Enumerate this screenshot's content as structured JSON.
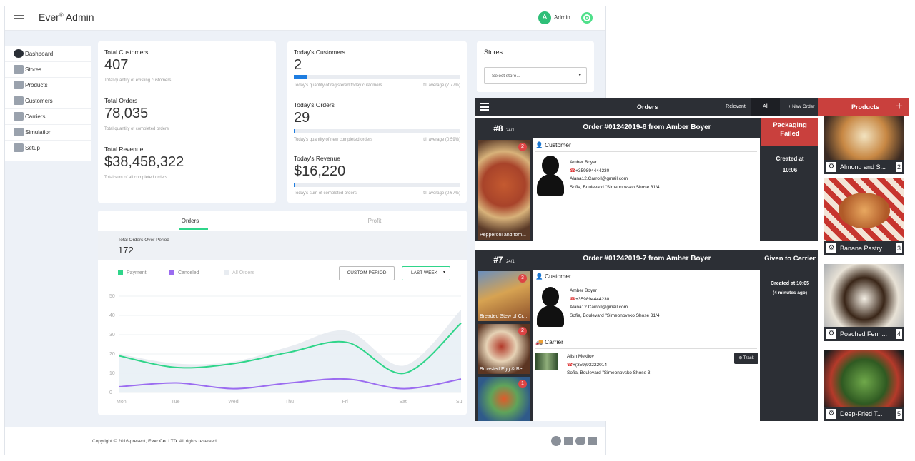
{
  "admin": {
    "brand": "Ever",
    "brand_sup": "®",
    "brand_suffix": " Admin",
    "avatar_letter": "A",
    "user": "Admin",
    "sidebar": [
      {
        "label": "Dashboard",
        "icon": "dashboard-icon"
      },
      {
        "label": "Stores",
        "icon": "stores-icon"
      },
      {
        "label": "Products",
        "icon": "products-icon"
      },
      {
        "label": "Customers",
        "icon": "customers-icon"
      },
      {
        "label": "Carriers",
        "icon": "carriers-icon"
      },
      {
        "label": "Simulation",
        "icon": "simulation-icon"
      },
      {
        "label": "Setup",
        "icon": "setup-icon"
      }
    ],
    "stats_left": [
      {
        "title": "Total Customers",
        "value": "407",
        "sub": "Total quantity of existing customers"
      },
      {
        "title": "Total Orders",
        "value": "78,035",
        "sub": "Total quantity of completed orders"
      },
      {
        "title": "Total Revenue",
        "value": "$38,458,322",
        "sub": "Total sum of all completed orders"
      }
    ],
    "stats_right": [
      {
        "title": "Today's Customers",
        "value": "2",
        "sub": "Today's quantity of registered today customers",
        "till": "till average (7.77%)",
        "percent": 7.77
      },
      {
        "title": "Today's Orders",
        "value": "29",
        "sub": "Today's quantity of new completed orders",
        "till": "till average (0.59%)",
        "percent": 0.59
      },
      {
        "title": "Today's Revenue",
        "value": "$16,220",
        "sub": "Today's sum of completed orders",
        "till": "till average (0.67%)",
        "percent": 0.67
      }
    ],
    "stores": {
      "title": "Stores",
      "placeholder": "Select store..."
    },
    "tabs": [
      "Orders",
      "Profit"
    ],
    "period_label": "Total Orders Over Period",
    "period_value": "172",
    "legend": [
      {
        "label": "Payment",
        "color": "#2fd58a"
      },
      {
        "label": "Canceled",
        "color": "#9b6cf0"
      },
      {
        "label": "All Orders",
        "color": "#e8ecf1"
      }
    ],
    "custom_period": "CUSTOM PERIOD",
    "last_week": "LAST WEEK",
    "footer_prefix": "Copyright © 2016-present, ",
    "footer_company": "Ever Co. LTD.",
    "footer_suffix": " All rights reserved."
  },
  "chart_data": {
    "type": "line",
    "x": [
      "Mon",
      "Tue",
      "Wed",
      "Thu",
      "Fri",
      "Sat",
      "Su"
    ],
    "ylim": [
      0,
      50
    ],
    "yticks": [
      "50",
      "40",
      "30",
      "20",
      "10",
      "0"
    ],
    "series": [
      {
        "name": "Payment",
        "values": [
          19,
          13,
          15,
          21,
          26,
          10,
          36
        ],
        "color": "#2fd58a"
      },
      {
        "name": "Canceled",
        "values": [
          3,
          5,
          2,
          5,
          7,
          2,
          7
        ],
        "color": "#9b6cf0"
      },
      {
        "name": "All Orders",
        "values": [
          20,
          15,
          16,
          24,
          32,
          14,
          43
        ],
        "color": "#e3e8ef"
      }
    ]
  },
  "orders_app": {
    "menu_icon": "hamburger-icon",
    "title": "Orders",
    "relevant": "Relevant",
    "all": "All",
    "new_order": "+ New Order",
    "products_title": "Products",
    "plus": "+",
    "orders": [
      {
        "num": "#8",
        "date": "24/1",
        "title": "Order #01242019-8 from Amber Boyer",
        "status": "Packaging Failed",
        "created": "Created at",
        "time": "10:06",
        "customer_label": "Customer",
        "name": "Amber Boyer",
        "phone": "+359894444230",
        "email": "Alana12.Carroll@gmail.com",
        "address": "Sofia, Boulevard \"Simeonovsko Shose 31/4",
        "items": [
          {
            "caption": "Pepperoni and tom...",
            "count": "2"
          }
        ]
      },
      {
        "num": "#7",
        "date": "24/1",
        "title": "Order #01242019-7 from Amber Boyer",
        "status": "Given to Carrier",
        "created": "Created at 10:05",
        "ago": "(4 minutes ago)",
        "customer_label": "Customer",
        "name": "Amber Boyer",
        "phone": "+359894444230",
        "email": "Alana12.Carroll@gmail.com",
        "address": "Sofia, Boulevard \"Simeonovsko Shose 31/4",
        "carrier_label": "Carrier",
        "carrier_name": "Alish Mekliov",
        "carrier_phone": "+(359)93222014",
        "carrier_address": "Sofia, Boulevard \"Simeonovsko Shose 3",
        "track": "Track",
        "items": [
          {
            "caption": "Breaded Stew of Cr...",
            "count": "3"
          },
          {
            "caption": "Broasted Egg & Be...",
            "count": "2"
          },
          {
            "caption": "",
            "count": "1"
          }
        ]
      }
    ],
    "products": [
      {
        "name": "Almond and S...",
        "count": "2"
      },
      {
        "name": "Banana Pastry",
        "count": "3"
      },
      {
        "name": "Poached Fenn...",
        "count": "4"
      },
      {
        "name": "Deep-Fried T...",
        "count": "5"
      }
    ]
  }
}
